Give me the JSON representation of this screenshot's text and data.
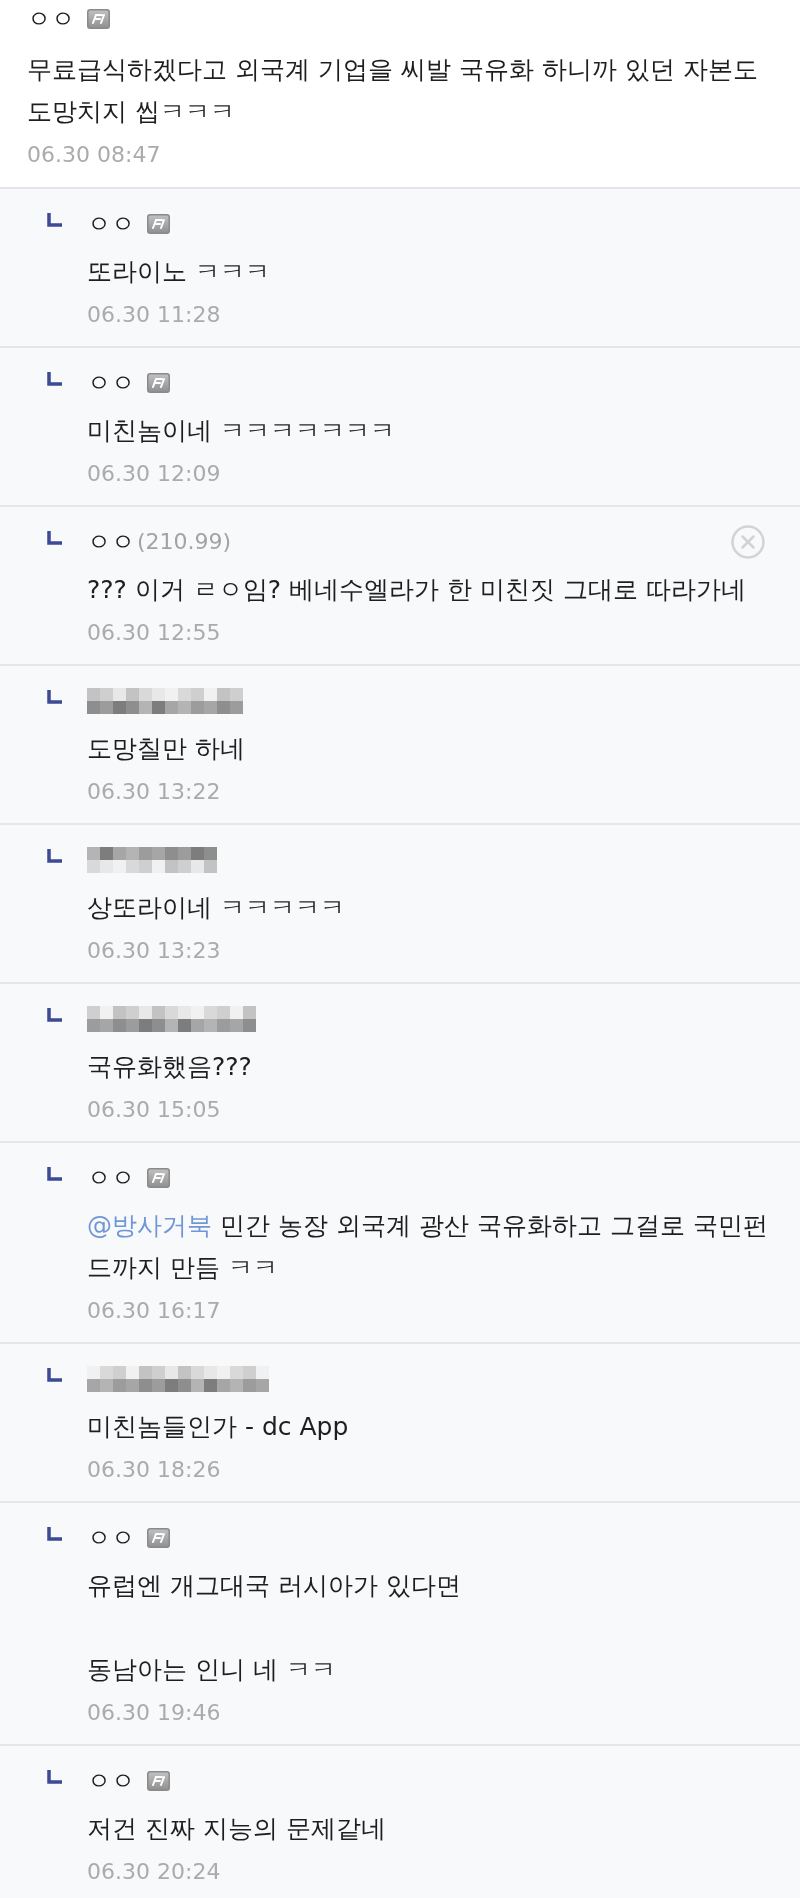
{
  "comment": {
    "author": {
      "kind": "fixed",
      "name": "ㅇㅇ"
    },
    "text": "무료급식하겠다고 외국계 기업을 씨발 국유화 하니까 있던 자본도 도망치지 씹ㅋㅋㅋ",
    "time": "06.30 08:47"
  },
  "replies": [
    {
      "author": {
        "kind": "fixed",
        "name": "ㅇㅇ"
      },
      "text": "또라이노 ㅋㅋㅋ",
      "time": "06.30 11:28",
      "deletable": false
    },
    {
      "author": {
        "kind": "fixed",
        "name": "ㅇㅇ"
      },
      "text": "미친놈이네 ㅋㅋㅋㅋㅋㅋㅋ",
      "time": "06.30 12:09",
      "deletable": false
    },
    {
      "author": {
        "kind": "ip",
        "name": "ㅇㅇ",
        "ip": "(210.99)"
      },
      "text": "??? 이거 ㄹㅇ임? 베네수엘라가 한 미친짓 그대로 따라가네",
      "time": "06.30 12:55",
      "deletable": true
    },
    {
      "author": {
        "kind": "mosaic"
      },
      "text": "도망칠만 하네",
      "time": "06.30 13:22",
      "deletable": false
    },
    {
      "author": {
        "kind": "mosaic"
      },
      "text": "상또라이네 ㅋㅋㅋㅋㅋ",
      "time": "06.30 13:23",
      "deletable": false
    },
    {
      "author": {
        "kind": "mosaic"
      },
      "text": "국유화했음???",
      "time": "06.30 15:05",
      "deletable": false
    },
    {
      "author": {
        "kind": "fixed",
        "name": "ㅇㅇ"
      },
      "mention": "@방사거북",
      "text": "민간 농장 외국계 광산 국유화하고 그걸로 국민펀드까지 만듬 ㅋㅋ",
      "time": "06.30 16:17",
      "deletable": false
    },
    {
      "author": {
        "kind": "mosaic"
      },
      "text": "미친놈들인가 - dc App",
      "time": "06.30 18:26",
      "deletable": false
    },
    {
      "author": {
        "kind": "fixed",
        "name": "ㅇㅇ"
      },
      "text": "유럽엔 개그대국 러시아가 있다면\n\n동남아는 인니 네 ㅋㅋ",
      "time": "06.30 19:46",
      "deletable": false
    },
    {
      "author": {
        "kind": "fixed",
        "name": "ㅇㅇ"
      },
      "text": "저건 진짜 지능의 문제같네",
      "time": "06.30 20:24",
      "deletable": false
    }
  ]
}
